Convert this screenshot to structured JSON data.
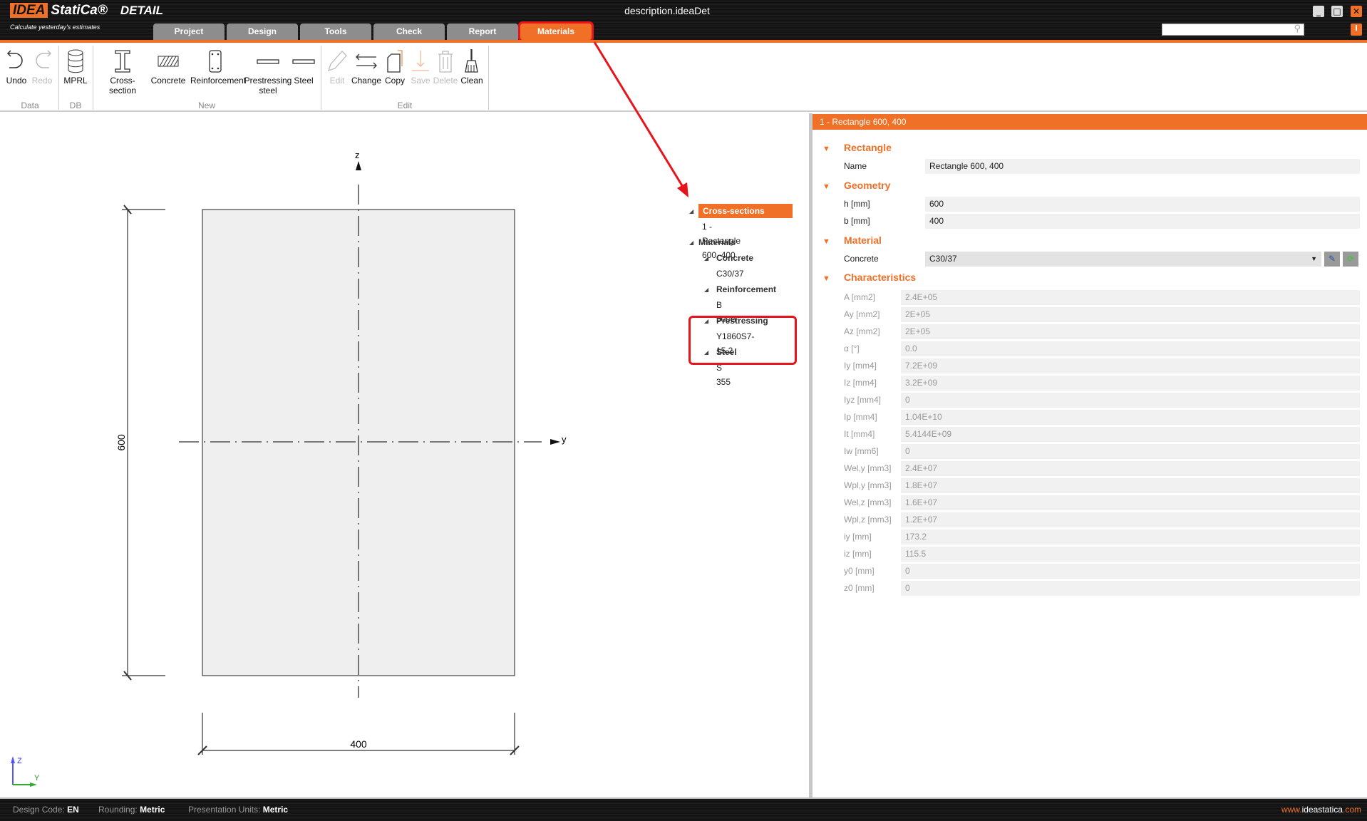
{
  "app": {
    "logo": "IDEA StatiCa",
    "logo_idea": "IDEA",
    "logo_statica": "StatiCa®",
    "product": "DETAIL",
    "tagline": "Calculate yesterday's estimates",
    "document_title": "description.ideaDet",
    "accent": "#f07027"
  },
  "tabs": [
    {
      "label": "Project"
    },
    {
      "label": "Design"
    },
    {
      "label": "Tools"
    },
    {
      "label": "Check"
    },
    {
      "label": "Report"
    },
    {
      "label": "Materials",
      "active": true
    }
  ],
  "ribbon": {
    "buttons": [
      {
        "id": "undo",
        "label": "Undo",
        "icon": "undo-icon"
      },
      {
        "id": "redo",
        "label": "Redo",
        "icon": "redo-icon",
        "disabled": true
      },
      {
        "id": "mprl",
        "label": "MPRL",
        "icon": "database-icon"
      },
      {
        "id": "cross-section",
        "label": "Cross-section",
        "icon": "i-beam-icon"
      },
      {
        "id": "concrete",
        "label": "Concrete",
        "icon": "hatched-rect-icon"
      },
      {
        "id": "reinforcement",
        "label": "Reinforcement",
        "icon": "rebar-section-icon"
      },
      {
        "id": "prestressing-steel",
        "label": "Prestressing steel",
        "icon": "flat-bar-icon"
      },
      {
        "id": "steel",
        "label": "Steel",
        "icon": "flat-bar-icon"
      },
      {
        "id": "edit",
        "label": "Edit",
        "icon": "pencil-icon",
        "disabled": true
      },
      {
        "id": "change",
        "label": "Change",
        "icon": "swap-arrows-icon"
      },
      {
        "id": "copy",
        "label": "Copy",
        "icon": "copy-icon"
      },
      {
        "id": "save",
        "label": "Save",
        "icon": "save-icon",
        "disabled": true
      },
      {
        "id": "delete",
        "label": "Delete",
        "icon": "trash-icon",
        "disabled": true
      },
      {
        "id": "clean",
        "label": "Clean",
        "icon": "broom-icon"
      }
    ],
    "groups": [
      {
        "label": "Data"
      },
      {
        "label": "DB"
      },
      {
        "label": "New"
      },
      {
        "label": "Edit"
      }
    ]
  },
  "drawing": {
    "z_axis": "z",
    "y_axis": "y",
    "height_dim": "600",
    "width_dim": "400",
    "triad_z": "Z",
    "triad_y": "Y"
  },
  "tree": [
    {
      "label": "Cross-sections",
      "level": 0,
      "selected": true
    },
    {
      "label": "1 - Rectangle 600, 400",
      "level": 1
    },
    {
      "label": "Materials",
      "level": 0
    },
    {
      "label": "Concrete",
      "level": 1,
      "group": true
    },
    {
      "label": "C30/37",
      "level": 2
    },
    {
      "label": "Reinforcement",
      "level": 1,
      "group": true
    },
    {
      "label": "B 500B",
      "level": 2
    },
    {
      "label": "Prestressing",
      "level": 1,
      "group": true
    },
    {
      "label": "Y1860S7-15.2",
      "level": 2
    },
    {
      "label": "Steel",
      "level": 1,
      "group": true
    },
    {
      "label": "S 355",
      "level": 2
    }
  ],
  "panel": {
    "header": "1 - Rectangle 600, 400",
    "sections": {
      "rectangle": "Rectangle",
      "geometry": "Geometry",
      "material": "Material",
      "characteristics": "Characteristics"
    },
    "name": {
      "label": "Name",
      "value": "Rectangle 600, 400"
    },
    "h": {
      "label": "h [mm]",
      "value": "600"
    },
    "b": {
      "label": "b [mm]",
      "value": "400"
    },
    "concrete": {
      "label": "Concrete",
      "value": "C30/37"
    },
    "characteristics": [
      {
        "label": "A [mm2]",
        "value": "2.4E+05"
      },
      {
        "label": "Ay [mm2]",
        "value": "2E+05"
      },
      {
        "label": "Az [mm2]",
        "value": "2E+05"
      },
      {
        "label": "α [°]",
        "value": "0.0"
      },
      {
        "label": "Iy [mm4]",
        "value": "7.2E+09"
      },
      {
        "label": "Iz [mm4]",
        "value": "3.2E+09"
      },
      {
        "label": "Iyz [mm4]",
        "value": "0"
      },
      {
        "label": "Ip [mm4]",
        "value": "1.04E+10"
      },
      {
        "label": "It [mm4]",
        "value": "5.4144E+09"
      },
      {
        "label": "Iw [mm6]",
        "value": "0"
      },
      {
        "label": "Wel,y [mm3]",
        "value": "2.4E+07"
      },
      {
        "label": "Wpl,y [mm3]",
        "value": "1.8E+07"
      },
      {
        "label": "Wel,z [mm3]",
        "value": "1.6E+07"
      },
      {
        "label": "Wpl,z [mm3]",
        "value": "1.2E+07"
      },
      {
        "label": "iy [mm]",
        "value": "173.2"
      },
      {
        "label": "iz [mm]",
        "value": "115.5"
      },
      {
        "label": "y0 [mm]",
        "value": "0"
      },
      {
        "label": "z0 [mm]",
        "value": "0"
      }
    ]
  },
  "status": {
    "design_code_label": "Design Code:",
    "design_code": "EN",
    "rounding_label": "Rounding:",
    "rounding": "Metric",
    "units_label": "Presentation Units:",
    "units": "Metric",
    "website_www": "www.",
    "website_main": "ideastatica",
    "website_tld": ".com"
  }
}
